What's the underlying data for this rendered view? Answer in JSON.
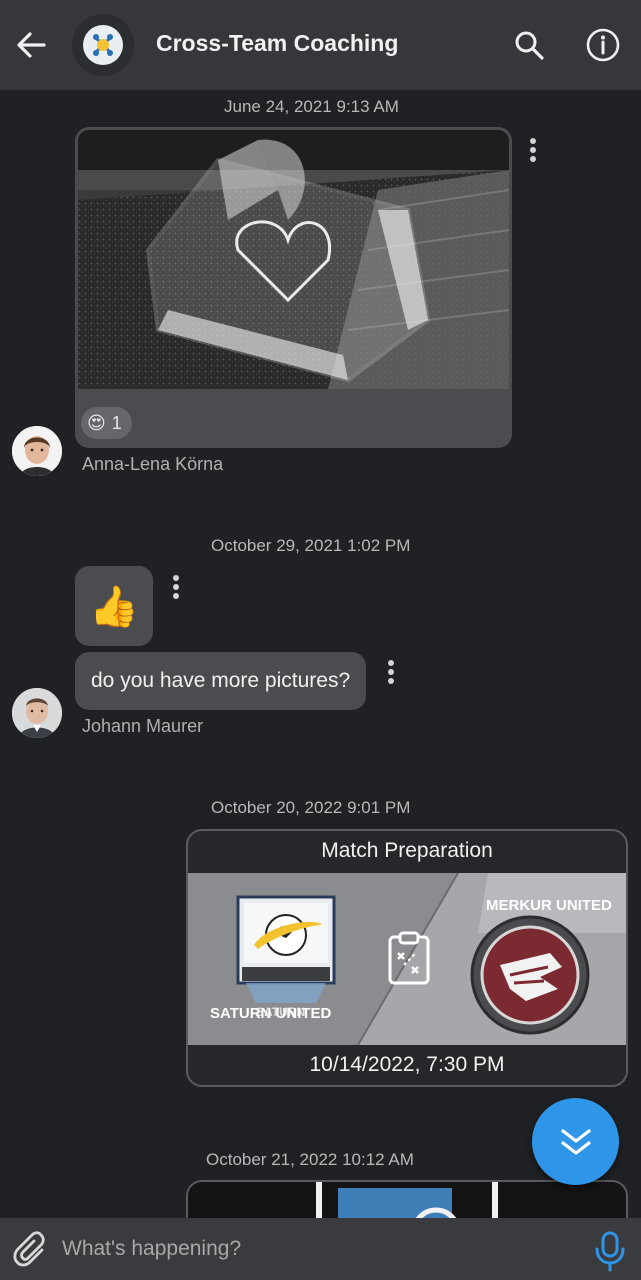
{
  "header": {
    "title": "Cross-Team Coaching",
    "back_icon": "arrow-left-icon",
    "search_icon": "search-icon",
    "info_icon": "info-icon"
  },
  "messages": {
    "group1": {
      "date": "June 24, 2021 9:13 AM",
      "reaction": {
        "emoji": "😍",
        "count": "1"
      },
      "sender": "Anna-Lena Körna"
    },
    "group2": {
      "date": "October 29, 2021 1:02 PM",
      "emoji_message": "👍",
      "text_message": "do you have more pictures?",
      "sender": "Johann Maurer"
    },
    "group3": {
      "date": "October 20, 2022 9:01 PM",
      "card_title": "Match Preparation",
      "home_team": "SATURN UNITED",
      "home_badge_text": "SATURN",
      "away_team": "MERKUR UNITED",
      "match_datetime": "10/14/2022, 7:30 PM"
    },
    "group4": {
      "date": "October 21, 2022 10:12 AM"
    }
  },
  "composer": {
    "placeholder": "What's happening?",
    "attach_icon": "paperclip-icon",
    "mic_icon": "microphone-icon"
  },
  "colors": {
    "background": "#202124",
    "topbar": "#36373b",
    "bubble": "#4b4c50",
    "accent": "#2f95e8"
  }
}
